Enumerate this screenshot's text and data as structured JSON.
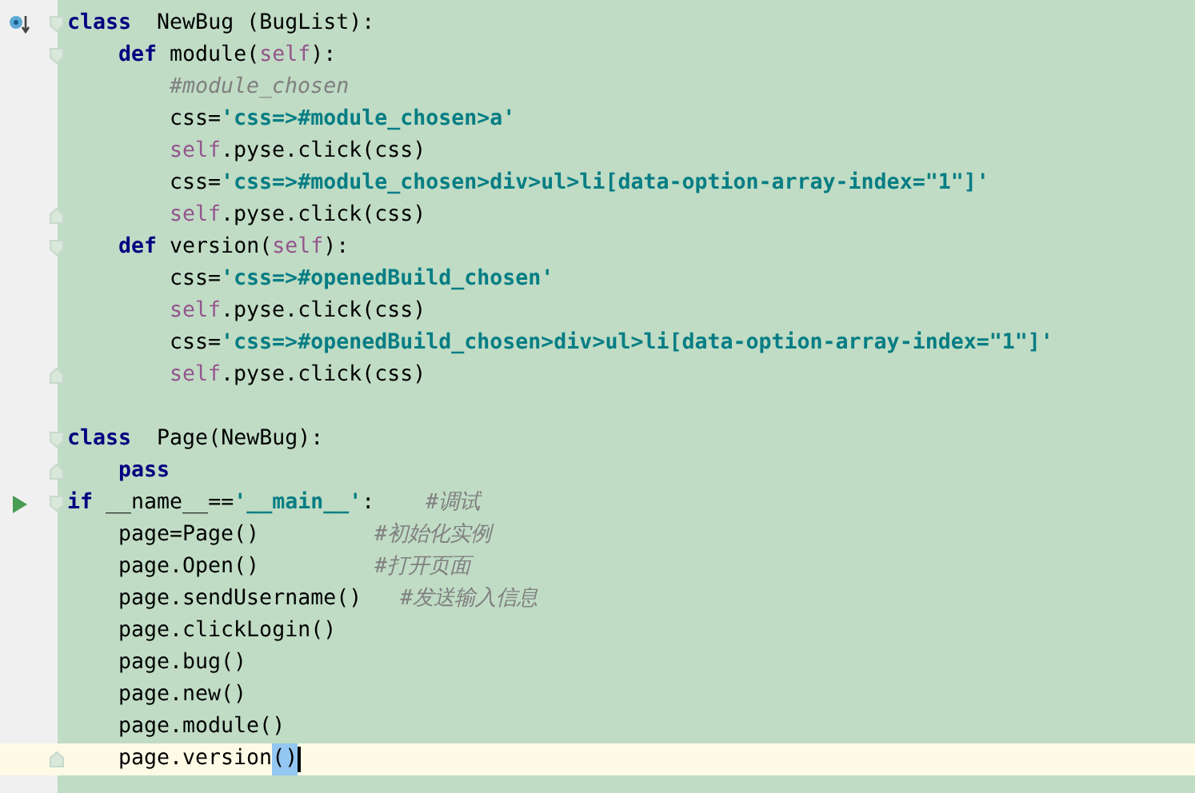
{
  "editor": {
    "lines": [
      {
        "overrides": true,
        "current": false,
        "tokens": [
          {
            "kind": "keyword",
            "text": "class"
          },
          {
            "kind": "text",
            "text": "  NewBug (BugList):"
          }
        ],
        "children": [
          {
            "current": false,
            "tokens": [
              {
                "kind": "keyword",
                "text": "def"
              },
              {
                "kind": "text",
                "text": " module("
              },
              {
                "kind": "self",
                "text": "self"
              },
              {
                "kind": "text",
                "text": "):"
              }
            ],
            "children": [
              {
                "current": false,
                "tokens": [
                  {
                    "kind": "comment",
                    "text": "#module_chosen"
                  }
                ]
              },
              {
                "current": false,
                "tokens": [
                  {
                    "kind": "text",
                    "text": "css="
                  },
                  {
                    "kind": "string",
                    "text": "'css=>#module_chosen>a'"
                  }
                ]
              },
              {
                "current": false,
                "tokens": [
                  {
                    "kind": "self",
                    "text": "self"
                  },
                  {
                    "kind": "text",
                    "text": ".pyse.click(css)"
                  }
                ]
              },
              {
                "current": false,
                "tokens": [
                  {
                    "kind": "text",
                    "text": "css="
                  },
                  {
                    "kind": "string",
                    "text": "'css=>#module_chosen>div>ul>li[data-option-array-index=\"1\"]'"
                  }
                ]
              },
              {
                "current": false,
                "tokens": [
                  {
                    "kind": "self",
                    "text": "self"
                  },
                  {
                    "kind": "text",
                    "text": ".pyse.click(css)"
                  }
                ]
              }
            ]
          },
          {
            "current": false,
            "tokens": [
              {
                "kind": "keyword",
                "text": "def"
              },
              {
                "kind": "text",
                "text": " version("
              },
              {
                "kind": "self",
                "text": "self"
              },
              {
                "kind": "text",
                "text": "):"
              }
            ],
            "children": [
              {
                "current": false,
                "tokens": [
                  {
                    "kind": "text",
                    "text": "css="
                  },
                  {
                    "kind": "string",
                    "text": "'css=>#openedBuild_chosen'"
                  }
                ]
              },
              {
                "current": false,
                "tokens": [
                  {
                    "kind": "self",
                    "text": "self"
                  },
                  {
                    "kind": "text",
                    "text": ".pyse.click(css)"
                  }
                ]
              },
              {
                "current": false,
                "tokens": [
                  {
                    "kind": "text",
                    "text": "css="
                  },
                  {
                    "kind": "string",
                    "text": "'css=>#openedBuild_chosen>div>ul>li[data-option-array-index=\"1\"]'"
                  }
                ]
              },
              {
                "current": false,
                "tokens": [
                  {
                    "kind": "self",
                    "text": "self"
                  },
                  {
                    "kind": "text",
                    "text": ".pyse.click(css)"
                  }
                ]
              }
            ]
          }
        ]
      },
      {
        "blank_before": true,
        "current": false,
        "tokens": [
          {
            "kind": "keyword",
            "text": "class"
          },
          {
            "kind": "text",
            "text": "  Page(NewBug):"
          }
        ],
        "children": [
          {
            "current": false,
            "tokens": [
              {
                "kind": "keyword",
                "text": "pass"
              }
            ]
          }
        ]
      },
      {
        "runnable": true,
        "current": false,
        "tokens": [
          {
            "kind": "keyword",
            "text": "if"
          },
          {
            "kind": "text",
            "text": " __name__=="
          },
          {
            "kind": "string",
            "text": "'__main__'"
          },
          {
            "kind": "text",
            "text": ":    "
          },
          {
            "kind": "comment",
            "text": "#调试"
          }
        ],
        "children": [
          {
            "current": false,
            "tokens": [
              {
                "kind": "text",
                "text": "page=Page()         "
              },
              {
                "kind": "comment",
                "text": "#初始化实例"
              }
            ]
          },
          {
            "current": false,
            "tokens": [
              {
                "kind": "text",
                "text": "page.Open()         "
              },
              {
                "kind": "comment",
                "text": "#打开页面"
              }
            ]
          },
          {
            "current": false,
            "tokens": [
              {
                "kind": "text",
                "text": "page.sendUsername()   "
              },
              {
                "kind": "comment",
                "text": "#发送输入信息"
              }
            ]
          },
          {
            "current": false,
            "tokens": [
              {
                "kind": "text",
                "text": "page.clickLogin()"
              }
            ]
          },
          {
            "current": false,
            "tokens": [
              {
                "kind": "text",
                "text": "page.bug()"
              }
            ]
          },
          {
            "current": false,
            "tokens": [
              {
                "kind": "text",
                "text": "page.new()"
              }
            ]
          },
          {
            "current": false,
            "tokens": [
              {
                "kind": "text",
                "text": "page.module()"
              }
            ]
          },
          {
            "current": true,
            "caret": true,
            "tokens": [
              {
                "kind": "text",
                "text": "page.version"
              },
              {
                "kind": "matched",
                "text": "()"
              }
            ]
          }
        ]
      }
    ]
  }
}
